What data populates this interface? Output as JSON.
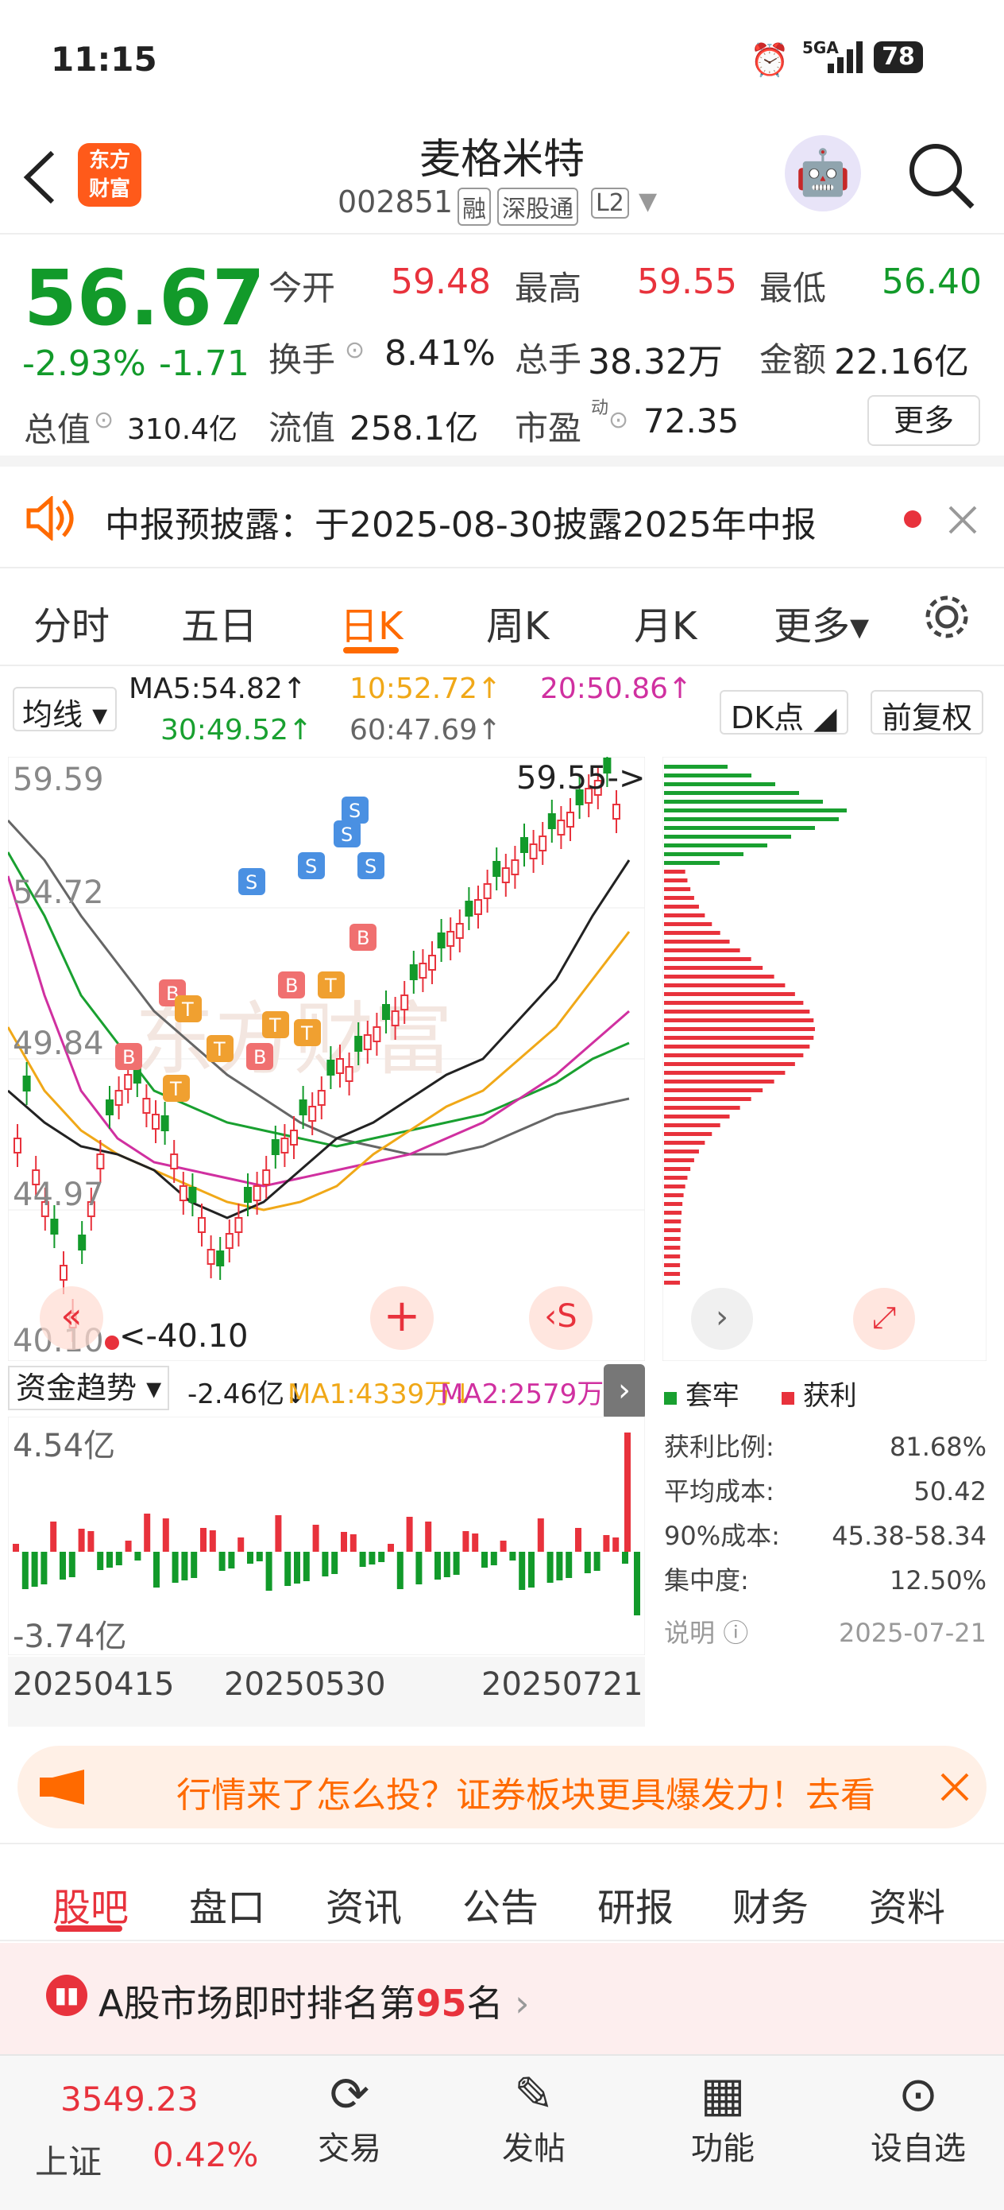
{
  "status": {
    "time": "11:15",
    "network": "5GA",
    "battery": "78"
  },
  "header": {
    "name": "麦格米特",
    "code": "002851",
    "tag_rong": "融",
    "tag_connect": "深股通",
    "tag_level": "L2"
  },
  "quote": {
    "price": "56.67",
    "pct": "-2.93%",
    "chg": "-1.71",
    "open_label": "今开",
    "open": "59.48",
    "high_label": "最高",
    "high": "59.55",
    "low_label": "最低",
    "low": "56.40",
    "turnover_label": "换手",
    "turnover": "8.41%",
    "volume_label": "总手",
    "volume": "38.32万",
    "amount_label": "金额",
    "amount": "22.16亿",
    "mcap_label": "总值",
    "mcap": "310.4亿",
    "float_label": "流值",
    "float": "258.1亿",
    "pe_label": "市盈",
    "pe_sup": "动",
    "pe": "72.35",
    "more": "更多"
  },
  "notice": {
    "text": "中报预披露：于2025-08-30披露2025年中报"
  },
  "ktabs": [
    "分时",
    "五日",
    "日K",
    "周K",
    "月K",
    "更多▾"
  ],
  "ma": {
    "select": "均线",
    "ma5": "MA5:54.82↑",
    "ma10": "10:52.72↑",
    "ma20": "20:50.86↑",
    "ma30": "30:49.52↑",
    "ma60": "60:47.69↑",
    "dk": "DK点",
    "fq": "前复权"
  },
  "chart": {
    "y_labels": [
      "59.59",
      "54.72",
      "49.84",
      "44.97",
      "40.10"
    ],
    "high_mark": "59.55->",
    "low_mark": "<-40.10",
    "watermark": "东方财富"
  },
  "fund": {
    "select": "资金趋势",
    "value": "-2.46亿↓",
    "ma1": "MA1:4339万↓",
    "ma2": "MA2:2579万↓",
    "top": "4.54亿",
    "bottom": "-3.74亿",
    "dates": [
      "20250415",
      "20250530",
      "20250721"
    ]
  },
  "chips": {
    "legend_trapped": "套牢",
    "legend_profit": "获利",
    "rows": [
      {
        "k": "获利比例:",
        "v": "81.68%"
      },
      {
        "k": "平均成本:",
        "v": "50.42"
      },
      {
        "k": "90%成本:",
        "v": "45.38-58.34"
      },
      {
        "k": "集中度:",
        "v": "12.50%"
      }
    ],
    "note": "说明",
    "date": "2025-07-21"
  },
  "ad": {
    "text": "行情来了怎么投？证券板块更具爆发力！去看"
  },
  "btabs": [
    "股吧",
    "盘口",
    "资讯",
    "公告",
    "研报",
    "财务",
    "资料"
  ],
  "rank": {
    "prefix": "A股市场即时排名第",
    "num": "95",
    "suffix": "名"
  },
  "index": {
    "value": "3549.23",
    "name": "上证",
    "pct": "0.42%"
  },
  "toolbar": [
    "交易",
    "发帖",
    "功能",
    "设自选"
  ],
  "colors": {
    "up": "#e8323c",
    "down": "#129a2a",
    "ma5": "#222222",
    "ma10": "#f0a818",
    "ma20": "#d030a0",
    "ma30": "#19a030",
    "ma60": "#666666",
    "accent": "#ff6a00"
  }
}
